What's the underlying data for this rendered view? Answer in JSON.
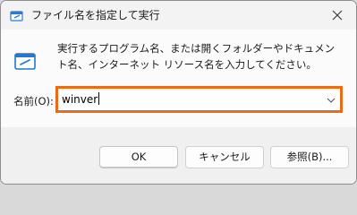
{
  "window": {
    "title": "ファイル名を指定して実行"
  },
  "main": {
    "description": "実行するプログラム名、または開くフォルダーやドキュメント名、インターネット リソース名を入力してください。",
    "name_label": "名前(O):",
    "name_input_value": "winver"
  },
  "buttons": {
    "ok": "OK",
    "cancel": "キャンセル",
    "browse": "参照(B)..."
  },
  "colors": {
    "input_highlight": "#ef6a17"
  }
}
